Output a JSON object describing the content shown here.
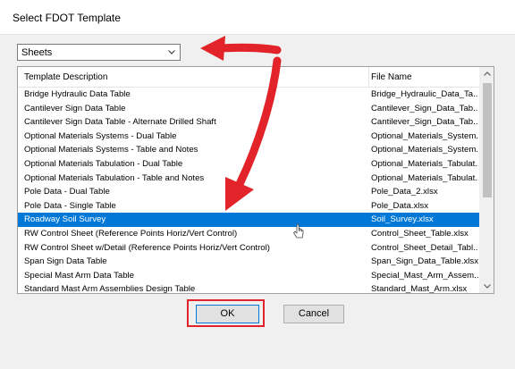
{
  "dialog": {
    "title": "Select FDOT Template"
  },
  "combo": {
    "value": "Sheets"
  },
  "table": {
    "columns": [
      "Template Description",
      "File Name"
    ],
    "rows": [
      {
        "desc": "Bridge Hydraulic Data Table",
        "file": "Bridge_Hydraulic_Data_Ta..."
      },
      {
        "desc": "Cantilever Sign Data Table",
        "file": "Cantilever_Sign_Data_Tab..."
      },
      {
        "desc": "Cantilever Sign Data Table - Alternate Drilled Shaft",
        "file": "Cantilever_Sign_Data_Tab..."
      },
      {
        "desc": "Optional Materials Systems - Dual Table",
        "file": "Optional_Materials_System..."
      },
      {
        "desc": "Optional Materials Systems - Table and Notes",
        "file": "Optional_Materials_System..."
      },
      {
        "desc": "Optional Materials Tabulation - Dual Table",
        "file": "Optional_Materials_Tabulat..."
      },
      {
        "desc": "Optional Materials Tabulation - Table and Notes",
        "file": "Optional_Materials_Tabulat..."
      },
      {
        "desc": "Pole Data - Dual Table",
        "file": "Pole_Data_2.xlsx"
      },
      {
        "desc": "Pole Data - Single Table",
        "file": "Pole_Data.xlsx"
      },
      {
        "desc": "Roadway Soil Survey",
        "file": "Soil_Survey.xlsx"
      },
      {
        "desc": "RW Control Sheet (Reference Points Horiz/Vert Control)",
        "file": "Control_Sheet_Table.xlsx"
      },
      {
        "desc": "RW Control Sheet w/Detail (Reference Points Horiz/Vert Control)",
        "file": "Control_Sheet_Detail_Tabl..."
      },
      {
        "desc": "Span Sign Data Table",
        "file": "Span_Sign_Data_Table.xlsx"
      },
      {
        "desc": "Special Mast Arm Data Table",
        "file": "Special_Mast_Arm_Assem..."
      },
      {
        "desc": "Standard Mast Arm Assemblies Design Table",
        "file": "Standard_Mast_Arm.xlsx"
      }
    ],
    "selected_index": 9
  },
  "buttons": {
    "ok": "OK",
    "cancel": "Cancel"
  },
  "colors": {
    "selection": "#0078d7",
    "annotation": "#e2242a"
  }
}
